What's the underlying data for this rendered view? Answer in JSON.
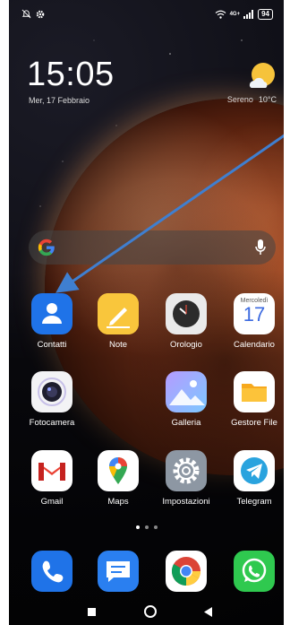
{
  "status_bar": {
    "left_icons": [
      "bell-muted-icon",
      "gear-icon"
    ],
    "right_icons": [
      "wifi-icon",
      "signal-icon",
      "battery-icon"
    ],
    "network": "4G+",
    "battery": "94"
  },
  "clock": {
    "time": "15:05",
    "date": "Mer, 17 Febbraio"
  },
  "weather": {
    "condition": "Sereno",
    "temperature": "10°C",
    "icon": "partly-sunny-icon"
  },
  "search": {
    "logo": "google-logo",
    "mic": "microphone-icon"
  },
  "apps": [
    {
      "label": "Contatti",
      "icon": "contacts-icon"
    },
    {
      "label": "Note",
      "icon": "notes-icon"
    },
    {
      "label": "Orologio",
      "icon": "clock-icon"
    },
    {
      "label": "Calendario",
      "icon": "calendar-icon",
      "weekday": "Mercoledì",
      "day": "17"
    },
    {
      "label": "Fotocamera",
      "icon": "camera-icon"
    },
    {
      "label": "Galleria",
      "icon": "gallery-icon"
    },
    {
      "label": "Gestore File",
      "icon": "folder-icon"
    },
    {
      "label": "Gmail",
      "icon": "gmail-icon"
    },
    {
      "label": "Maps",
      "icon": "maps-icon"
    },
    {
      "label": "Impostazioni",
      "icon": "settings-icon"
    },
    {
      "label": "Telegram",
      "icon": "telegram-icon"
    }
  ],
  "page_indicator": {
    "pages": 3,
    "active": 1
  },
  "dock": [
    {
      "icon": "phone-icon"
    },
    {
      "icon": "messages-icon"
    },
    {
      "icon": "chrome-icon"
    },
    {
      "icon": "whatsapp-icon"
    }
  ],
  "nav_bar": [
    "recents-button",
    "home-button",
    "back-button"
  ],
  "colors": {
    "annotation_arrow": "#3f7fd0"
  }
}
